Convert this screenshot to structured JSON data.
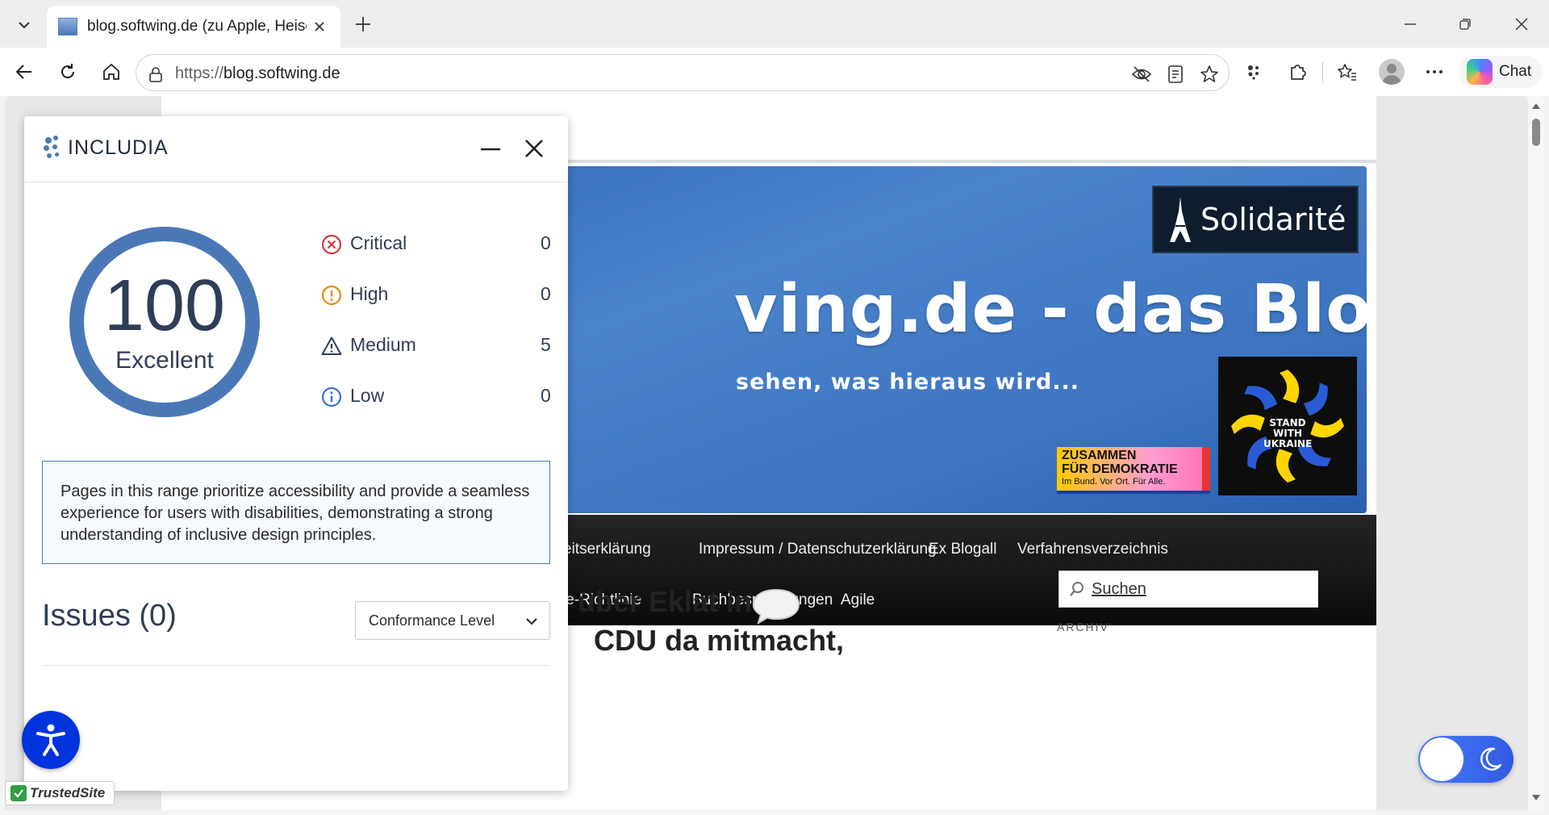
{
  "browser": {
    "tab_title": "blog.softwing.de (zu Apple, Heise,",
    "url_scheme": "https://",
    "url_host": "blog.softwing.de",
    "chat_label": "Chat"
  },
  "site": {
    "banner_title": "ving.de - das Blog",
    "banner_subtitle": "sehen, was hieraus wird...",
    "solidarite": "Solidarité",
    "ukraine_badge": "STAND WITH UKRAINE",
    "democracy_line1": "ZUSAMMEN",
    "democracy_line2": "FÜR DEMOKRATIE",
    "democracy_line3": "Im Bund. Vor Ort. Für Alle.",
    "nav_row1": [
      "eitserklärung",
      "Impressum / Datenschutzerklärung",
      "Ex Blogall",
      "Verfahrensverzeichnis"
    ],
    "nav_row2": [
      "ie-Richtlinie",
      "Buchbesprechungen",
      "Agile"
    ],
    "post_title_line1": "über Eklat in",
    "post_title_line2": "CDU da mitmacht,",
    "search_label": "Suchen",
    "archive_heading": "ARCHIV",
    "trusted_site": "TrustedSite"
  },
  "panel": {
    "brand": "INCLUDIA",
    "score": "100",
    "score_fraction": 1.0,
    "score_label": "Excellent",
    "severities": [
      {
        "label": "Critical",
        "count": "0",
        "icon": "critical-x-circle-icon",
        "color": "#d9363e"
      },
      {
        "label": "High",
        "count": "0",
        "icon": "high-exclamation-circle-icon",
        "color": "#e09000"
      },
      {
        "label": "Medium",
        "count": "5",
        "icon": "medium-warning-triangle-icon",
        "color": "#2f3d57"
      },
      {
        "label": "Low",
        "count": "0",
        "icon": "low-info-circle-icon",
        "color": "#3a6fd8"
      }
    ],
    "description": "Pages in this range prioritize accessibility and provide a seamless experience for users with disabilities, demonstrating a strong understanding of inclusive design principles.",
    "issues_title": "Issues (0)",
    "conformance_select": "Conformance Level"
  },
  "colors": {
    "accent": "#4a78b7",
    "fab": "#0033dd",
    "toggle": "#3a6bf0"
  }
}
